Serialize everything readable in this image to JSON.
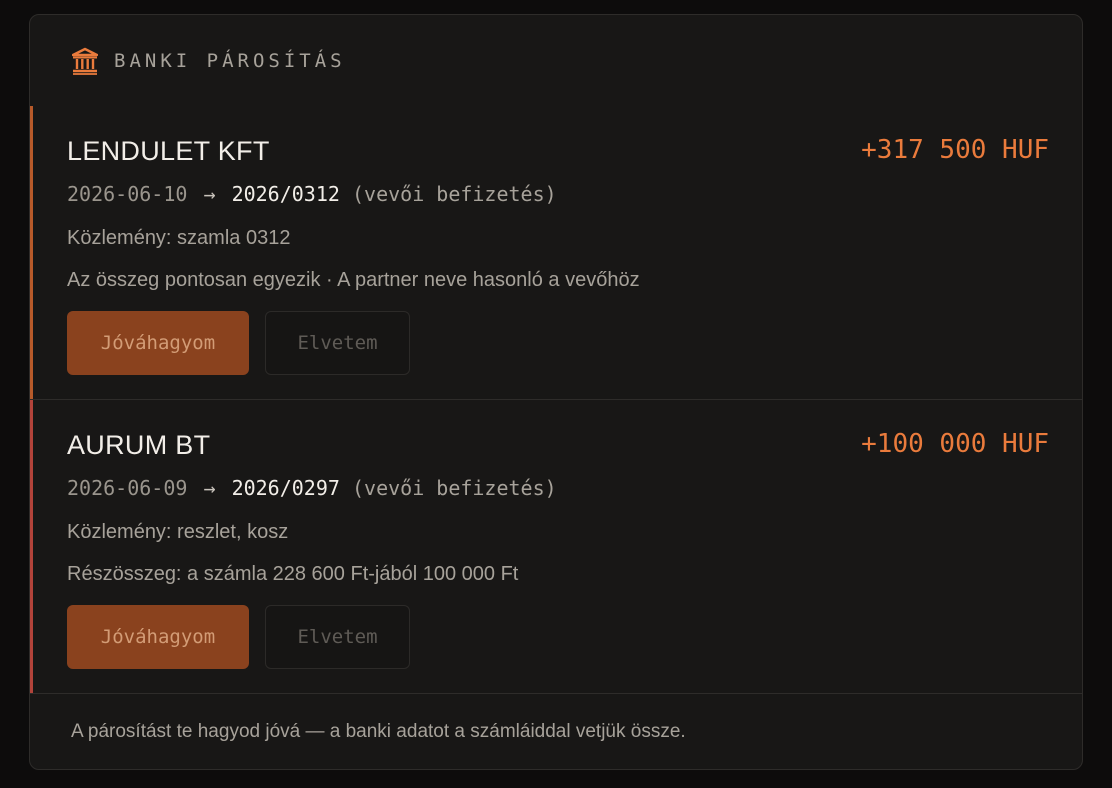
{
  "panel": {
    "title": "BANKI PÁROSÍTÁS",
    "icon": "bank-icon",
    "accent_color": "#ea7b3c"
  },
  "matches": [
    {
      "party": "LENDULET KFT",
      "amount": "+317 500 HUF",
      "date": "2026-06-10",
      "arrow": "→",
      "invoice": "2026/0312",
      "kind": "(vevői befizetés)",
      "memo": "Közlemény: szamla 0312",
      "note": "Az összeg pontosan egyezik · A partner neve hasonló a vevőhöz",
      "approve_label": "Jóváhagyom",
      "reject_label": "Elvetem"
    },
    {
      "party": "AURUM BT",
      "amount": "+100 000 HUF",
      "date": "2026-06-09",
      "arrow": "→",
      "invoice": "2026/0297",
      "kind": "(vevői befizetés)",
      "memo": "Közlemény: reszlet, kosz",
      "note": "Részösszeg: a számla 228 600 Ft-jából 100 000 Ft",
      "approve_label": "Jóváhagyom",
      "reject_label": "Elvetem"
    }
  ],
  "footer": "A párosítást te hagyod jóvá — a banki adatot a számláiddal vetjük össze."
}
